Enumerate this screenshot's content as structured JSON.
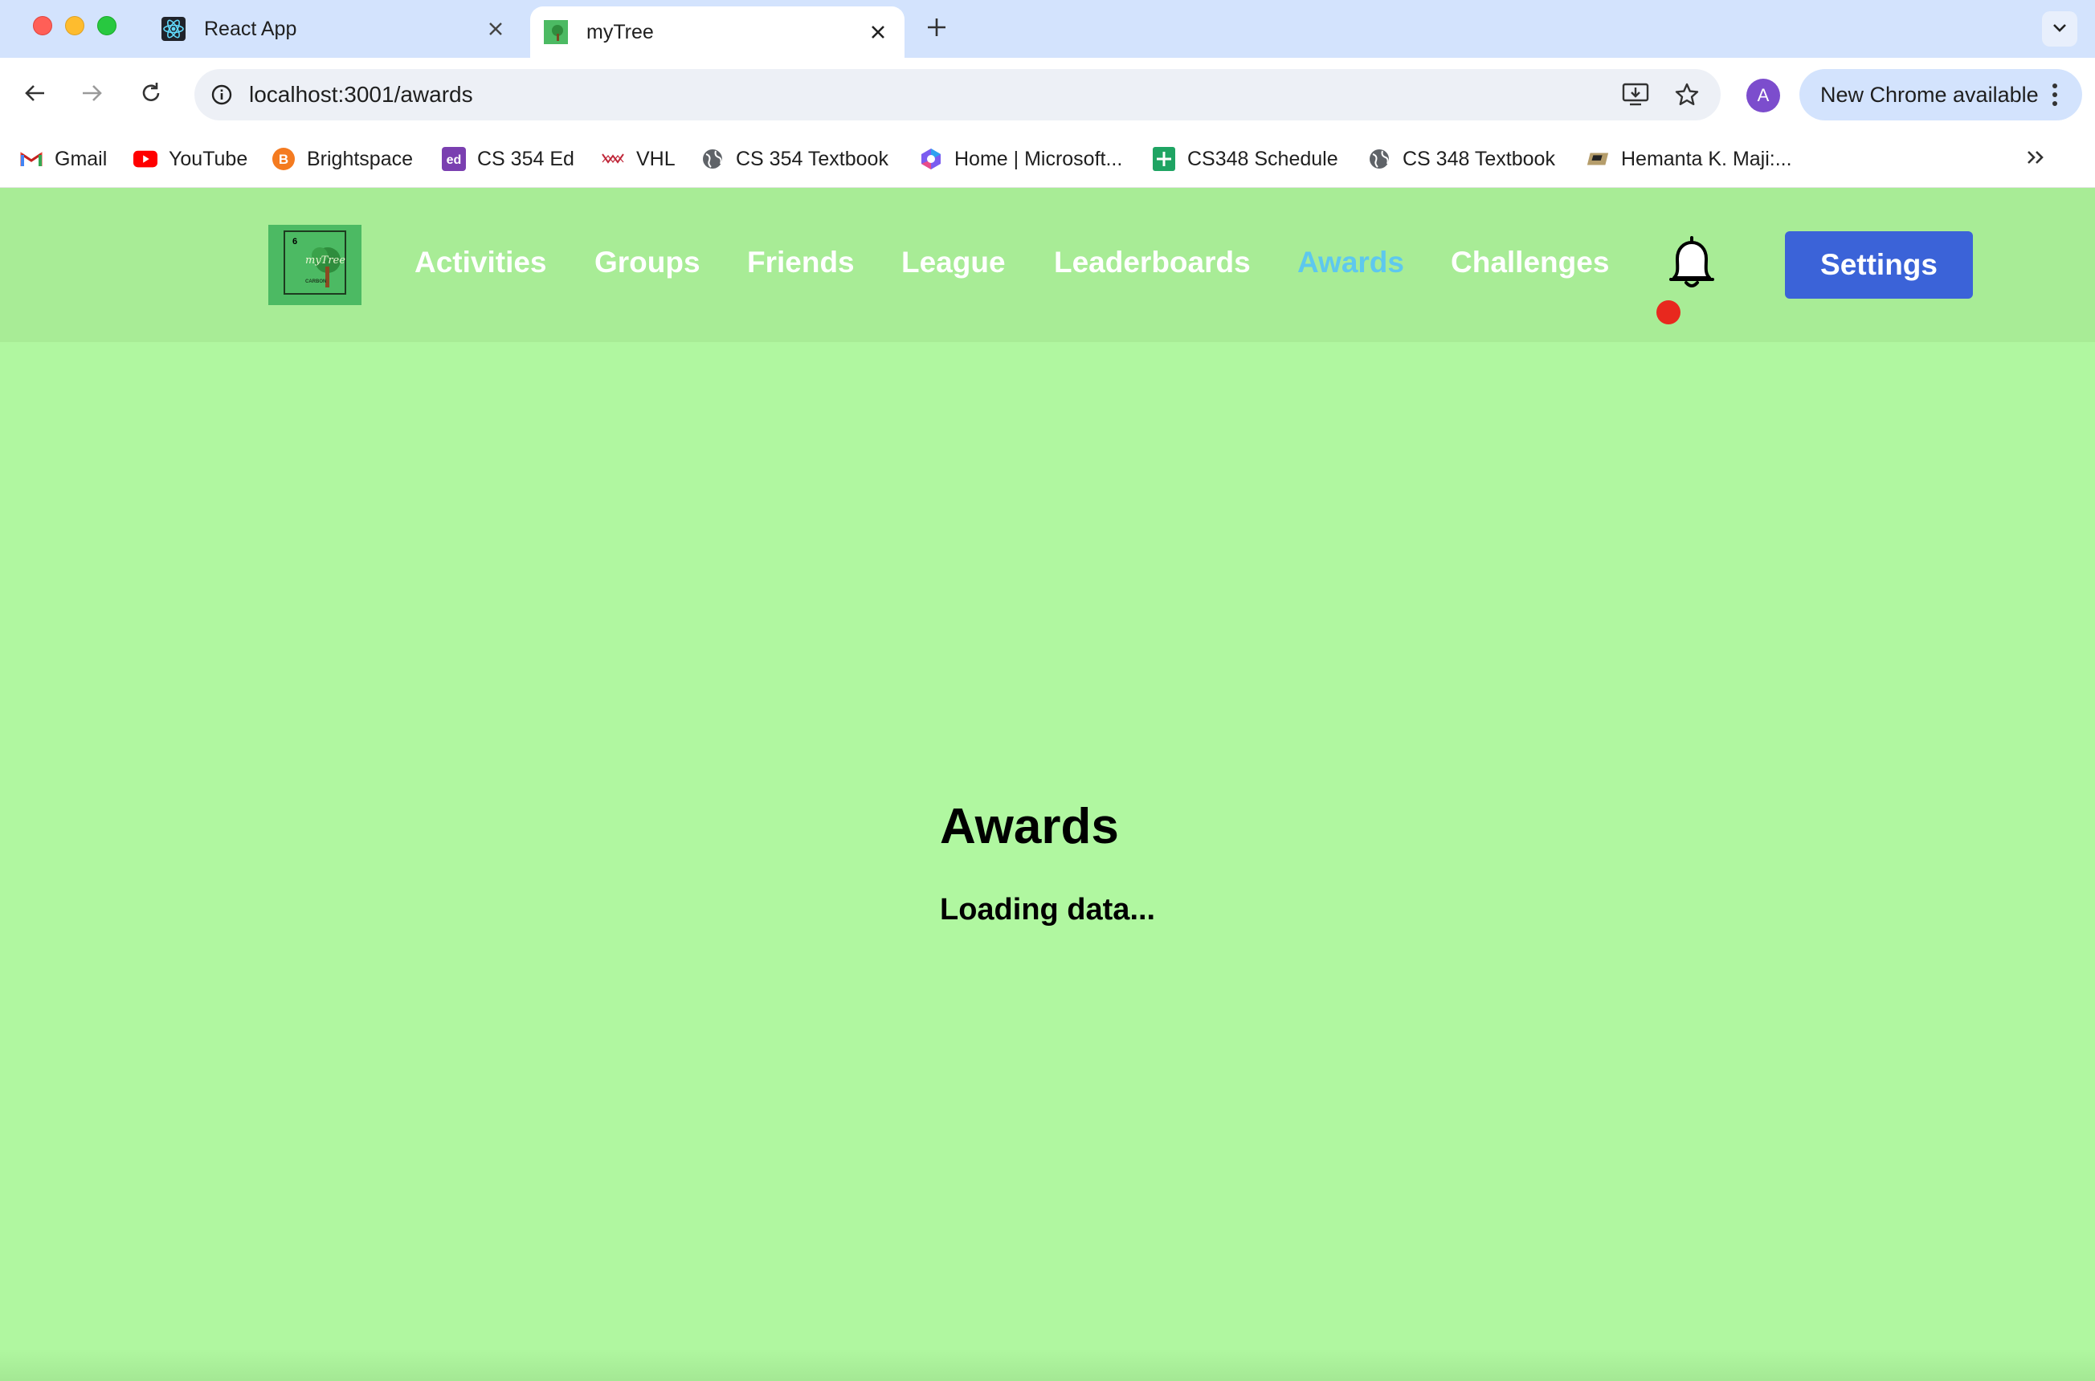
{
  "browser": {
    "tabs": [
      {
        "title": "React App",
        "icon": "react-icon"
      },
      {
        "title": "myTree",
        "icon": "mytree-favicon",
        "active": true
      }
    ],
    "url": "localhost:3001/awards",
    "profile_initial": "A",
    "update_chip_label": "New Chrome available",
    "bookmarks": [
      {
        "label": "Gmail",
        "icon": "gmail-icon"
      },
      {
        "label": "YouTube",
        "icon": "youtube-icon"
      },
      {
        "label": "Brightspace",
        "icon": "brightspace-icon"
      },
      {
        "label": "CS 354 Ed",
        "icon": "ed-icon"
      },
      {
        "label": "VHL",
        "icon": "vhl-icon"
      },
      {
        "label": "CS 354 Textbook",
        "icon": "globe-icon"
      },
      {
        "label": "Home | Microsoft...",
        "icon": "microsoft-icon"
      },
      {
        "label": "CS348 Schedule",
        "icon": "sheets-icon"
      },
      {
        "label": "CS 348 Textbook",
        "icon": "globe-icon"
      },
      {
        "label": "Hemanta K. Maji:...",
        "icon": "purdue-icon"
      }
    ]
  },
  "app": {
    "logo": {
      "text": "myTree",
      "number": "6",
      "caption": "CARBON"
    },
    "nav": [
      {
        "label": "Activities"
      },
      {
        "label": "Groups"
      },
      {
        "label": "Friends"
      },
      {
        "label": "League"
      },
      {
        "label": "Leaderboards"
      },
      {
        "label": "Awards",
        "active": true
      },
      {
        "label": "Challenges"
      }
    ],
    "settings_label": "Settings",
    "notification_icon": "bell-icon"
  },
  "main": {
    "title": "Awards",
    "status": "Loading data..."
  },
  "colors": {
    "page_bg": "#b0f7a0",
    "header_bg": "#a8ec96",
    "nav_active": "#5ec8ee",
    "settings_button": "#3b63d8",
    "notification_dot": "#e8281e"
  }
}
